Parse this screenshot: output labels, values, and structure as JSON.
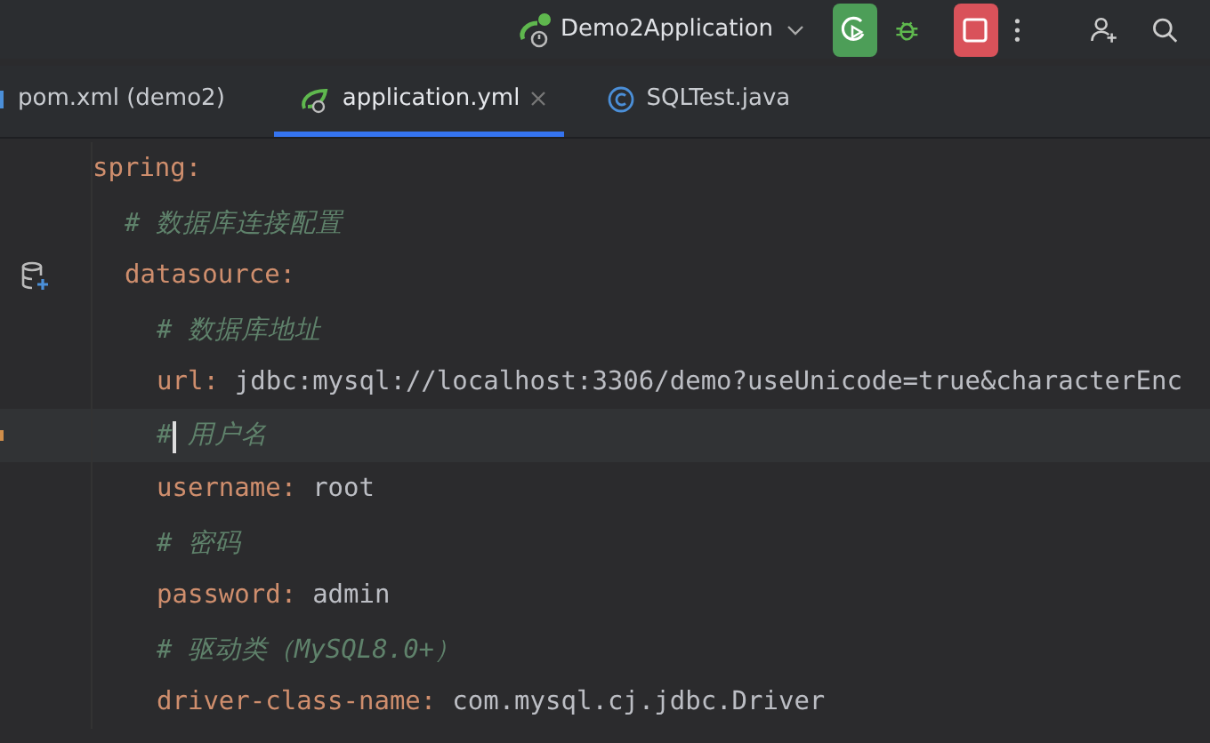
{
  "toolbar": {
    "run_configuration": "Demo2Application"
  },
  "tabs": [
    {
      "label": "pom.xml (demo2)",
      "kind": "maven",
      "selected": false
    },
    {
      "label": "application.yml",
      "kind": "spring",
      "selected": true
    },
    {
      "label": "SQLTest.java",
      "kind": "class",
      "selected": false
    }
  ],
  "editor": {
    "lines": [
      {
        "kind": "key",
        "key": "spring:",
        "current": false,
        "children": [
          {
            "kind": "comment",
            "text": "# 数据库连接配置",
            "current": false
          },
          {
            "kind": "key",
            "key": "datasource:",
            "gutter_icon": true,
            "current": false,
            "children": [
              {
                "kind": "comment",
                "text": "# 数据库地址",
                "current": false
              },
              {
                "kind": "pair",
                "key": "url:",
                "value": "jdbc:mysql://localhost:3306/demo?useUnicode=true&characterEnc",
                "current": false
              },
              {
                "kind": "comment",
                "text": "# 用户名",
                "current": true
              },
              {
                "kind": "pair",
                "key": "username:",
                "value": "root",
                "current": false
              },
              {
                "kind": "comment",
                "text": "# 密码",
                "current": false
              },
              {
                "kind": "pair",
                "key": "password:",
                "value": "admin",
                "current": false
              },
              {
                "kind": "comment",
                "text": "# 驱动类（MySQL8.0+）",
                "current": false
              },
              {
                "kind": "pair",
                "key": "driver-class-name:",
                "value": "com.mysql.cj.jdbc.Driver",
                "current": false
              }
            ]
          }
        ]
      }
    ]
  }
}
